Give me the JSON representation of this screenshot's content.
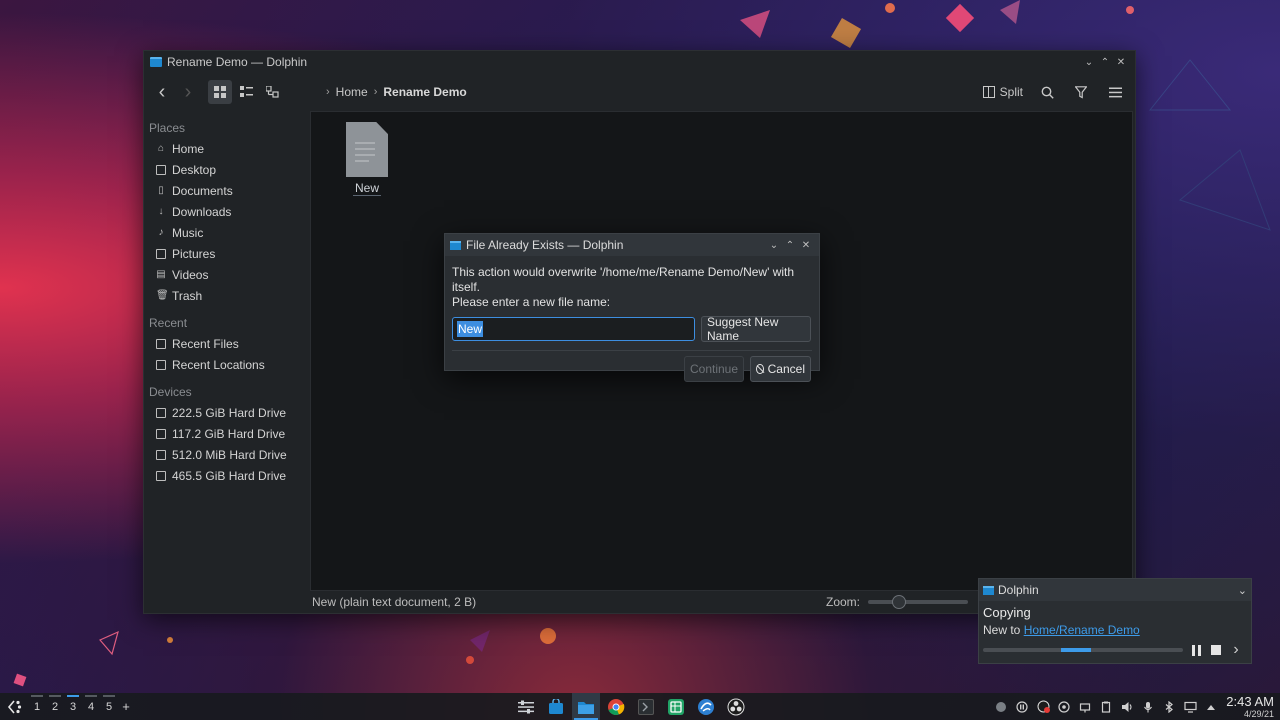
{
  "window": {
    "title": "Rename Demo — Dolphin",
    "controls": {
      "minimize": "⌄",
      "maximize": "⌃",
      "close": "✕"
    }
  },
  "toolbar": {
    "back_icon": "‹",
    "forward_icon": "›",
    "breadcrumb": {
      "home": "Home",
      "current": "Rename Demo"
    },
    "split_label": "Split"
  },
  "sidebar": {
    "places_heading": "Places",
    "places": [
      {
        "label": "Home",
        "icon": "home-icon"
      },
      {
        "label": "Desktop",
        "icon": "desktop-icon"
      },
      {
        "label": "Documents",
        "icon": "documents-icon"
      },
      {
        "label": "Downloads",
        "icon": "downloads-icon"
      },
      {
        "label": "Music",
        "icon": "music-icon"
      },
      {
        "label": "Pictures",
        "icon": "pictures-icon"
      },
      {
        "label": "Videos",
        "icon": "videos-icon"
      },
      {
        "label": "Trash",
        "icon": "trash-icon"
      }
    ],
    "recent_heading": "Recent",
    "recent": [
      {
        "label": "Recent Files",
        "icon": "recent-files-icon"
      },
      {
        "label": "Recent Locations",
        "icon": "recent-locations-icon"
      }
    ],
    "devices_heading": "Devices",
    "devices": [
      {
        "label": "222.5 GiB Hard Drive",
        "icon": "hard-drive-icon"
      },
      {
        "label": "117.2 GiB Hard Drive",
        "icon": "hard-drive-icon"
      },
      {
        "label": "512.0 MiB Hard Drive",
        "icon": "hard-drive-icon"
      },
      {
        "label": "465.5 GiB Hard Drive",
        "icon": "hard-drive-icon"
      }
    ]
  },
  "content": {
    "files": [
      {
        "name": "New",
        "icon": "text-file-icon"
      }
    ]
  },
  "statusbar": {
    "info": "New (plain text document, 2 B)",
    "zoom_label": "Zoom:"
  },
  "dialog": {
    "title": "File Already Exists — Dolphin",
    "message_line1": "This action would overwrite '/home/me/Rename Demo/New' with itself.",
    "message_line2": "Please enter a new file name:",
    "input_value": "New",
    "suggest_label": "Suggest New Name",
    "continue_label": "Continue",
    "cancel_label": "Cancel"
  },
  "notification": {
    "app": "Dolphin",
    "title": "Copying",
    "body_prefix": "New to ",
    "body_link": "Home/Rename Demo"
  },
  "panel": {
    "desktops": [
      "1",
      "2",
      "3",
      "4",
      "5"
    ],
    "add_label": "+",
    "time": "2:43 AM",
    "date": "4/29/21"
  },
  "colors": {
    "accent": "#3d9be9",
    "window_bg": "#202326",
    "content_bg": "#141618"
  }
}
